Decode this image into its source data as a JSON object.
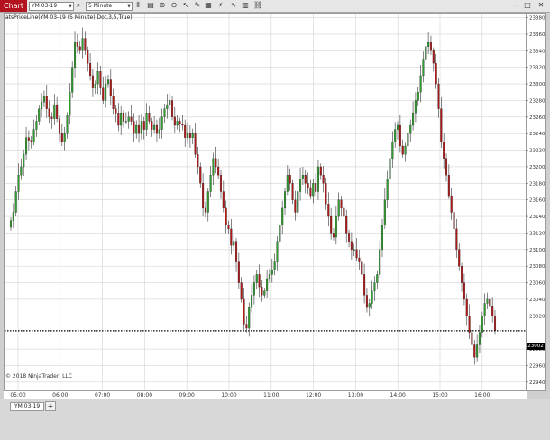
{
  "toolbar": {
    "chart_label": "Chart",
    "instrument": "YM 03-19",
    "interval": "5 Minute"
  },
  "indicator_label": "atsPriceLine(YM 03-19 (5 Minute),Dot,3,5,True)",
  "copyright": "© 2018 NinjaTrader, LLC",
  "bottom_tab": {
    "symbol": "YM 03-19",
    "add_label": "+"
  },
  "axis": {
    "price_ticks": [
      "23380",
      "23360",
      "23340",
      "23320",
      "23300",
      "23280",
      "23260",
      "23240",
      "23220",
      "23200",
      "23180",
      "23160",
      "23140",
      "23120",
      "23100",
      "23080",
      "23060",
      "23040",
      "23020",
      "22980",
      "22960",
      "22940"
    ],
    "time_ticks": [
      "05:00",
      "06:00",
      "07:00",
      "08:00",
      "09:00",
      "10:00",
      "11:00",
      "12:00",
      "13:00",
      "14:00",
      "15:00",
      "16:00"
    ]
  },
  "price_line": {
    "value": "23002",
    "color": "#000000"
  },
  "colors": {
    "up": "#2e9e2e",
    "down": "#b01818",
    "grid": "#d3d3d3",
    "wick": "#333333"
  },
  "chart_data": {
    "type": "candlestick",
    "y_range": [
      22930,
      23385
    ],
    "price_line": 23002,
    "x_ticks": [
      "05:00",
      "06:00",
      "07:00",
      "08:00",
      "09:00",
      "10:00",
      "11:00",
      "12:00",
      "13:00",
      "14:00",
      "15:00",
      "16:00"
    ],
    "closes": [
      23135,
      23145,
      23170,
      23190,
      23200,
      23215,
      23235,
      23232,
      23230,
      23245,
      23255,
      23270,
      23278,
      23285,
      23270,
      23260,
      23258,
      23275,
      23258,
      23240,
      23230,
      23240,
      23262,
      23290,
      23320,
      23350,
      23345,
      23340,
      23355,
      23340,
      23325,
      23310,
      23295,
      23300,
      23315,
      23295,
      23280,
      23300,
      23305,
      23285,
      23270,
      23265,
      23250,
      23265,
      23255,
      23255,
      23260,
      23255,
      23240,
      23250,
      23240,
      23255,
      23245,
      23265,
      23255,
      23245,
      23250,
      23240,
      23245,
      23260,
      23270,
      23275,
      23280,
      23260,
      23250,
      23255,
      23252,
      23250,
      23235,
      23240,
      23235,
      23240,
      23215,
      23200,
      23180,
      23150,
      23145,
      23170,
      23190,
      23210,
      23200,
      23190,
      23170,
      23150,
      23130,
      23125,
      23105,
      23110,
      23085,
      23060,
      23040,
      23010,
      23005,
      23030,
      23045,
      23060,
      23070,
      23055,
      23045,
      23050,
      23065,
      23070,
      23075,
      23085,
      23110,
      23130,
      23150,
      23170,
      23190,
      23180,
      23160,
      23145,
      23170,
      23185,
      23190,
      23180,
      23175,
      23165,
      23180,
      23170,
      23200,
      23190,
      23180,
      23155,
      23140,
      23120,
      23115,
      23140,
      23160,
      23150,
      23140,
      23120,
      23110,
      23100,
      23100,
      23090,
      23085,
      23070,
      23045,
      23030,
      23035,
      23050,
      23060,
      23070,
      23100,
      23130,
      23160,
      23185,
      23210,
      23230,
      23245,
      23250,
      23225,
      23215,
      23225,
      23240,
      23250,
      23265,
      23280,
      23290,
      23310,
      23330,
      23345,
      23350,
      23340,
      23325,
      23300,
      23270,
      23230,
      23210,
      23190,
      23165,
      23145,
      23125,
      23100,
      23080,
      23060,
      23040,
      23020,
      23000,
      22985,
      22970,
      22985,
      23000,
      23020,
      23035,
      23040,
      23032,
      23020,
      23002
    ]
  }
}
